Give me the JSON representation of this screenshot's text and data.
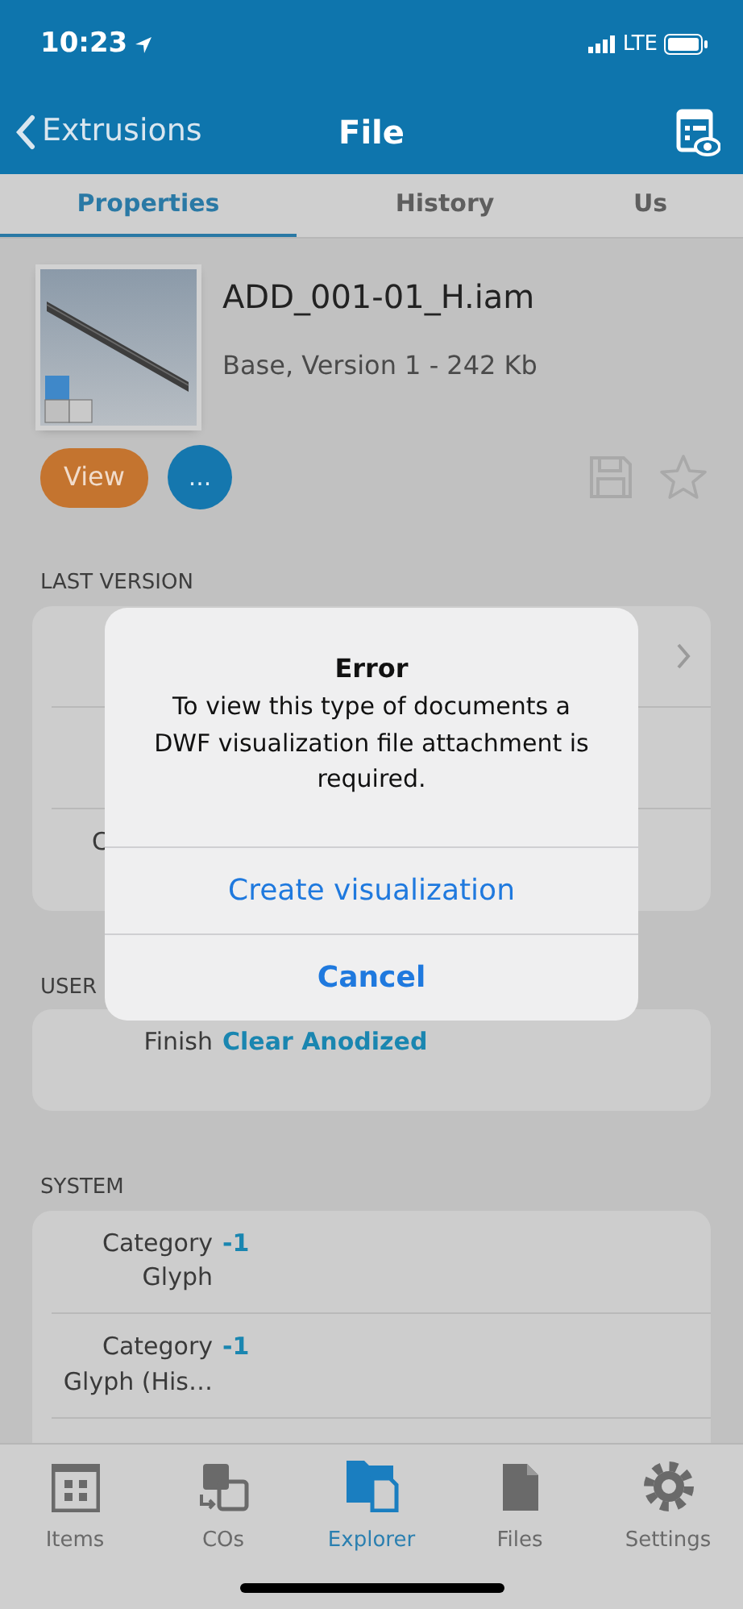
{
  "status_bar": {
    "time": "10:23",
    "network": "LTE"
  },
  "nav": {
    "back": "Extrusions",
    "title": "File"
  },
  "tabs": [
    {
      "label": "Properties",
      "selected": true
    },
    {
      "label": "History",
      "selected": false
    },
    {
      "label": "Us",
      "selected": false
    }
  ],
  "file": {
    "name": "ADD_001-01_H.iam",
    "info": "Base, Version 1 - 242 Kb",
    "view_button": "View",
    "more_button": "...",
    "starred": false
  },
  "sections": [
    {
      "header": "LAST VERSION",
      "rows": [
        {
          "kind": "link"
        },
        {
          "kind": "plain"
        },
        {
          "kind": "covered",
          "label": "C"
        }
      ]
    },
    {
      "header": "USER",
      "rows": [
        {
          "kind": "plain",
          "label": "Finish",
          "value": "Clear Anodized"
        }
      ]
    },
    {
      "header": "SYSTEM",
      "rows": [
        {
          "kind": "plain",
          "label": "Category Glyph",
          "value": "-1"
        },
        {
          "kind": "plain",
          "label": "Category Glyph (His…",
          "value": "-1"
        },
        {
          "kind": "plain"
        }
      ]
    }
  ],
  "dialog": {
    "title": "Error",
    "message": "To view this type of documents a DWF visualization file attachment is required.",
    "buttons": [
      {
        "label": "Create visualization",
        "kind": "default"
      },
      {
        "label": "Cancel",
        "kind": "cancel"
      }
    ]
  },
  "tab_bar": [
    {
      "label": "Items",
      "selected": false
    },
    {
      "label": "COs",
      "selected": false
    },
    {
      "label": "Explorer",
      "selected": true
    },
    {
      "label": "Files",
      "selected": false
    },
    {
      "label": "Settings",
      "selected": false
    }
  ]
}
